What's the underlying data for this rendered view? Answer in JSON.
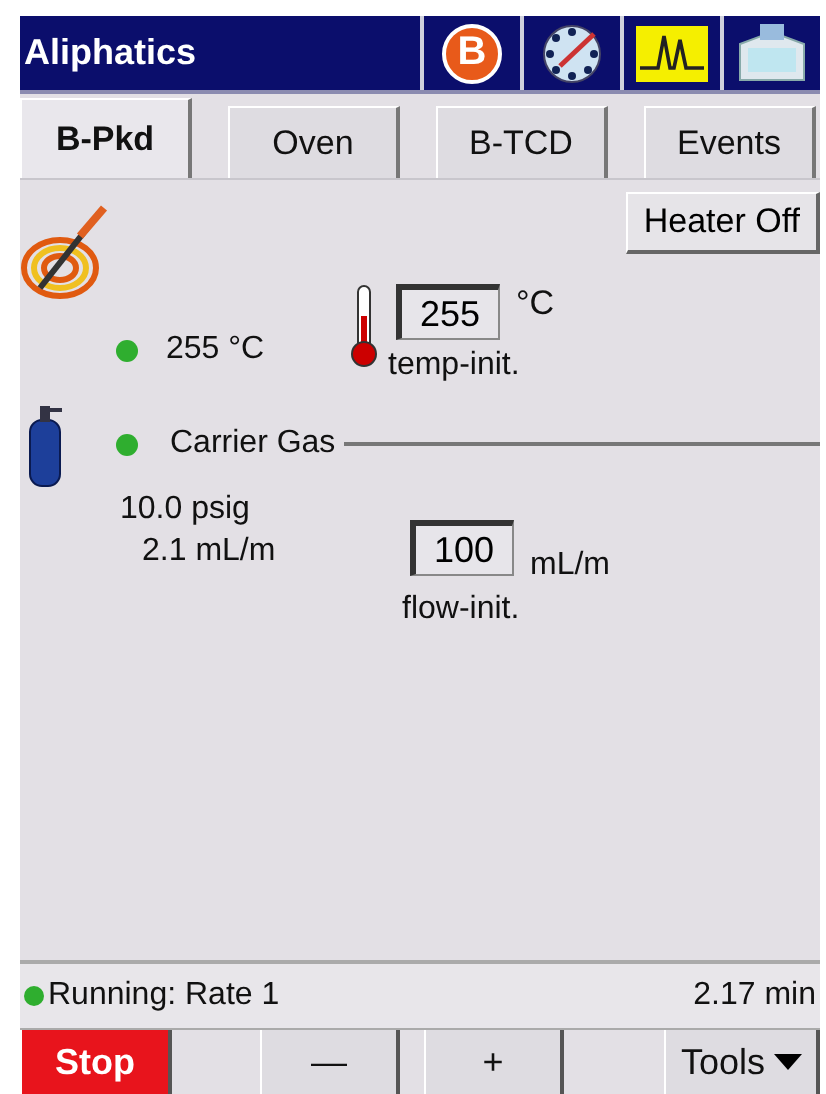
{
  "window": {
    "title": "Aliphatics",
    "badge_letter": "B"
  },
  "tabs": [
    {
      "label": "B-Pkd",
      "selected": true
    },
    {
      "label": "Oven",
      "selected": false
    },
    {
      "label": "B-TCD",
      "selected": false
    },
    {
      "label": "Events",
      "selected": false
    }
  ],
  "heater_button": "Heater Off",
  "temperature": {
    "ready": true,
    "actual": "255 °C",
    "setpoint": "255",
    "unit": "°C",
    "label": "temp-init."
  },
  "carrier_gas": {
    "ready": true,
    "title": "Carrier Gas",
    "pressure": "10.0 psig",
    "flow": "2.1 mL/m",
    "setpoint": "100",
    "unit": "mL/m",
    "label": "flow-init."
  },
  "status_bar": {
    "ready": true,
    "text": "Running: Rate 1",
    "time": "2.17 min"
  },
  "buttons": [
    {
      "label": "Stop",
      "kind": "stop"
    },
    {
      "label": "—",
      "kind": "plain"
    },
    {
      "label": "+",
      "kind": "plain"
    },
    {
      "label": "Tools",
      "kind": "menu"
    }
  ]
}
